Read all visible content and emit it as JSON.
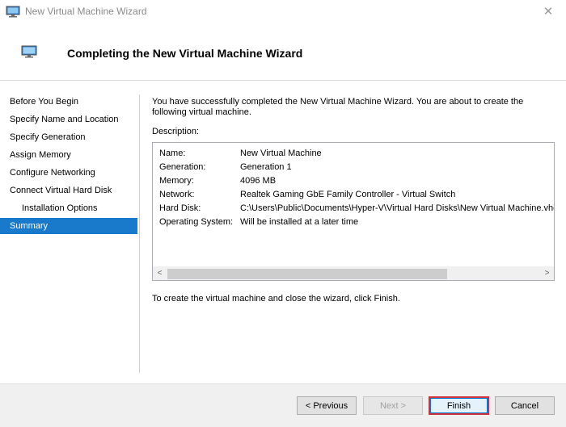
{
  "window": {
    "title": "New Virtual Machine Wizard",
    "close_glyph": "✕",
    "app_icon": "monitor-icon"
  },
  "header": {
    "title": "Completing the New Virtual Machine Wizard",
    "icon": "monitor-icon"
  },
  "sidebar": {
    "items": [
      {
        "label": "Before You Begin"
      },
      {
        "label": "Specify Name and Location"
      },
      {
        "label": "Specify Generation"
      },
      {
        "label": "Assign Memory"
      },
      {
        "label": "Configure Networking"
      },
      {
        "label": "Connect Virtual Hard Disk"
      },
      {
        "label": "Installation Options"
      },
      {
        "label": "Summary"
      }
    ],
    "active": "Summary"
  },
  "main": {
    "intro": "You have successfully completed the New Virtual Machine Wizard. You are about to create the following virtual machine.",
    "description_label": "Description:",
    "description": [
      {
        "key": "Name:",
        "value": "New Virtual Machine"
      },
      {
        "key": "Generation:",
        "value": "Generation 1"
      },
      {
        "key": "Memory:",
        "value": "4096 MB"
      },
      {
        "key": "Network:",
        "value": "Realtek Gaming GbE Family Controller - Virtual Switch"
      },
      {
        "key": "Hard Disk:",
        "value": "C:\\Users\\Public\\Documents\\Hyper-V\\Virtual Hard Disks\\New Virtual Machine.vhdx"
      },
      {
        "key": "Operating System:",
        "value": "Will be installed at a later time"
      }
    ],
    "scroll_left_glyph": "<",
    "scroll_right_glyph": ">",
    "finish_note": "To create the virtual machine and close the wizard, click Finish."
  },
  "footer": {
    "previous_label": "< Previous",
    "next_label": "Next >",
    "finish_label": "Finish",
    "cancel_label": "Cancel"
  },
  "colors": {
    "accent": "#1979ca",
    "finish_highlight": "#d0343a"
  }
}
